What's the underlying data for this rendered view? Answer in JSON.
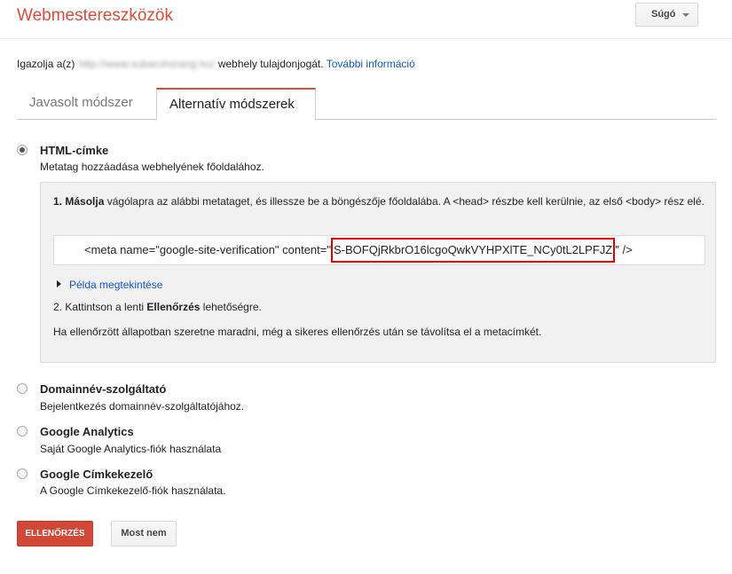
{
  "header": {
    "app_title": "Webmestereszközök",
    "help_label": "Súgó"
  },
  "verify": {
    "prefix": "Igazolja a(z)",
    "site_url": "http://www.subaruhorang.hu/",
    "suffix": "webhely tulajdonjogát.",
    "more_info_link": "További információ"
  },
  "tabs": [
    {
      "label": "Javasolt módszer",
      "active": false
    },
    {
      "label": "Alternatív módszerek",
      "active": true
    }
  ],
  "options": {
    "html_tag": {
      "title": "HTML-címke",
      "desc": "Metatag hozzáadása webhelyének főoldalához.",
      "selected": true,
      "panel": {
        "step1_number": "1.",
        "step1_bold": "Másolja",
        "step1_text": "vágólapra az alábbi metataget, és illessze be a böngészője főoldalába. A <head> részbe kell kerülnie, az első <body> rész elé.",
        "meta_prefix": "<meta name=\"google-site-verification\" content=\"",
        "meta_token": "S-BOFQjRkbrO16lcgoQwkVYHPXlTE_NCy0tL2LPFJZ",
        "meta_suffix": "\" />",
        "example_link": "Példa megtekintése",
        "step2_prefix": "2. Kattintson a lenti",
        "step2_bold": "Ellenőrzés",
        "step2_suffix": "lehetőségre.",
        "note": "Ha ellenőrzött állapotban szeretne maradni, még a sikeres ellenőrzés után se távolítsa el a metacímkét."
      }
    },
    "domain": {
      "title": "Domainnév-szolgáltató",
      "desc": "Bejelentkezés domainnév-szolgáltatójához.",
      "selected": false
    },
    "analytics": {
      "title": "Google Analytics",
      "desc": "Saját Google Analytics-fiók használata",
      "selected": false
    },
    "tag_manager": {
      "title": "Google Címkekezelő",
      "desc": "A Google Címkekezelő-fiók használata.",
      "selected": false
    }
  },
  "actions": {
    "verify_label": "ELLENŐRZÉS",
    "not_now_label": "Most nem"
  },
  "colors": {
    "brand_red": "#dd4b39",
    "button_red": "#d14836",
    "link_blue": "#1155cc",
    "highlight_red": "#e00000"
  }
}
